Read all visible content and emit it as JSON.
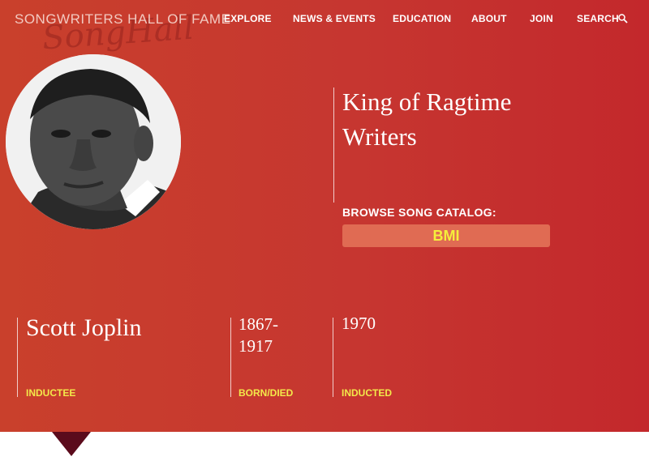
{
  "header": {
    "logo_text": "SONGWRITERS HALL OF FAME",
    "logo_script": "SongHall",
    "nav": [
      {
        "label": "EXPLORE"
      },
      {
        "label": "NEWS & EVENTS"
      },
      {
        "label": "EDUCATION"
      },
      {
        "label": "ABOUT"
      },
      {
        "label": "JOIN"
      },
      {
        "label": "SEARCH"
      }
    ],
    "search_icon": "magnifier-icon"
  },
  "hero": {
    "tagline": "King of Ragtime Writers",
    "browse_label": "BROWSE SONG CATALOG:",
    "catalog_button": "BMI"
  },
  "facts": {
    "name": "Scott Joplin",
    "name_label": "INDUCTEE",
    "born_died_line1": "1867-",
    "born_died_line2": "1917",
    "born_died_label": "BORN/DIED",
    "inducted_year": "1970",
    "inducted_label": "INDUCTED"
  },
  "colors": {
    "hero_start": "#c9402c",
    "hero_end": "#c3282c",
    "label_yellow": "#f3e84a",
    "button_bg": "#e06b53",
    "triangle": "#5b0b1c"
  }
}
